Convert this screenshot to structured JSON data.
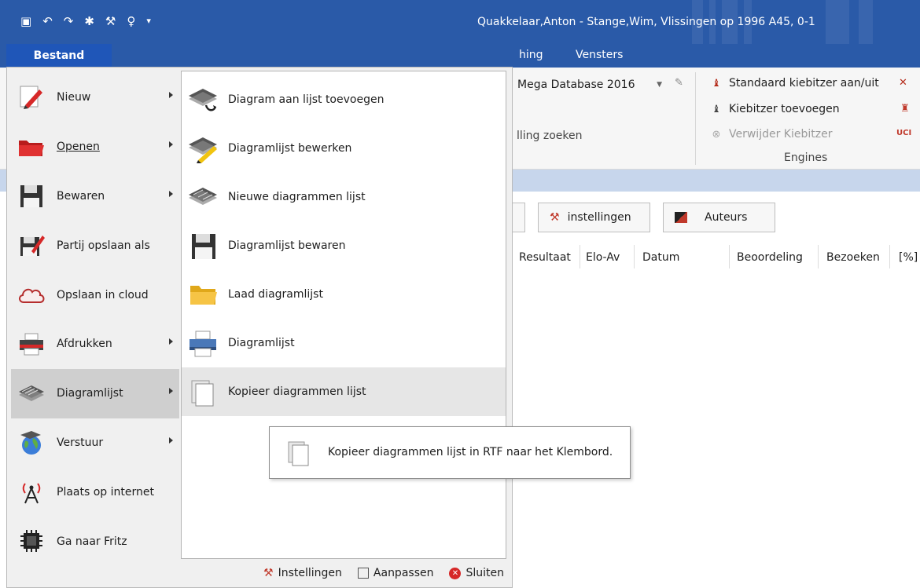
{
  "window": {
    "title": "Quakkelaar,Anton - Stange,Wim, Vlissingen op 1996  A45, 0-1",
    "accent": "#2a5aa8"
  },
  "quick_access": [
    "save-icon",
    "undo-icon",
    "redo-icon",
    "bug-icon",
    "wrench-icon",
    "bulb-icon",
    "customize-arrow-icon"
  ],
  "ribbon": {
    "file_tab": "Bestand",
    "tabs": [
      "hing",
      "Vensters"
    ],
    "database_select": "Mega Database 2016",
    "search_group_label": "lling zoeken",
    "engines": {
      "standard_kibitzer": "Standaard kiebitzer aan/uit",
      "add_kibitzer": "Kiebitzer toevoegen",
      "remove_kibitzer": "Verwijder Kiebitzer",
      "group_label": "Engines"
    }
  },
  "toolbar": {
    "settings_button": "instellingen",
    "authors_button": "Auteurs"
  },
  "columns": [
    "Resultaat",
    "Elo-Av",
    "Datum",
    "Beoordeling",
    "Bezoeken",
    "[%]"
  ],
  "file_menu": {
    "items": [
      {
        "label": "Nieuw",
        "submenu": true
      },
      {
        "label": "Openen",
        "submenu": true
      },
      {
        "label": "Bewaren",
        "submenu": true
      },
      {
        "label": "Partij opslaan als",
        "submenu": false
      },
      {
        "label": "Opslaan in cloud",
        "submenu": false
      },
      {
        "label": "Afdrukken",
        "submenu": true
      },
      {
        "label": "Diagramlijst",
        "submenu": true
      },
      {
        "label": "Verstuur",
        "submenu": true
      },
      {
        "label": "Plaats op internet",
        "submenu": false
      },
      {
        "label": "Ga naar Fritz",
        "submenu": false
      }
    ],
    "active_item": "Diagramlijst",
    "submenu_items": [
      "Diagram aan lijst toevoegen",
      "Diagramlijst bewerken",
      "Nieuwe diagrammen lijst",
      "Diagramlijst bewaren",
      "Laad diagramlijst",
      "Diagramlijst",
      "Kopieer diagrammen lijst"
    ],
    "active_submenu_item": "Kopieer diagrammen lijst",
    "footer": {
      "settings": "Instellingen",
      "customize": "Aanpassen",
      "close": "Sluiten"
    }
  },
  "tooltip": {
    "text": "Kopieer diagrammen lijst in RTF naar het Klembord."
  }
}
